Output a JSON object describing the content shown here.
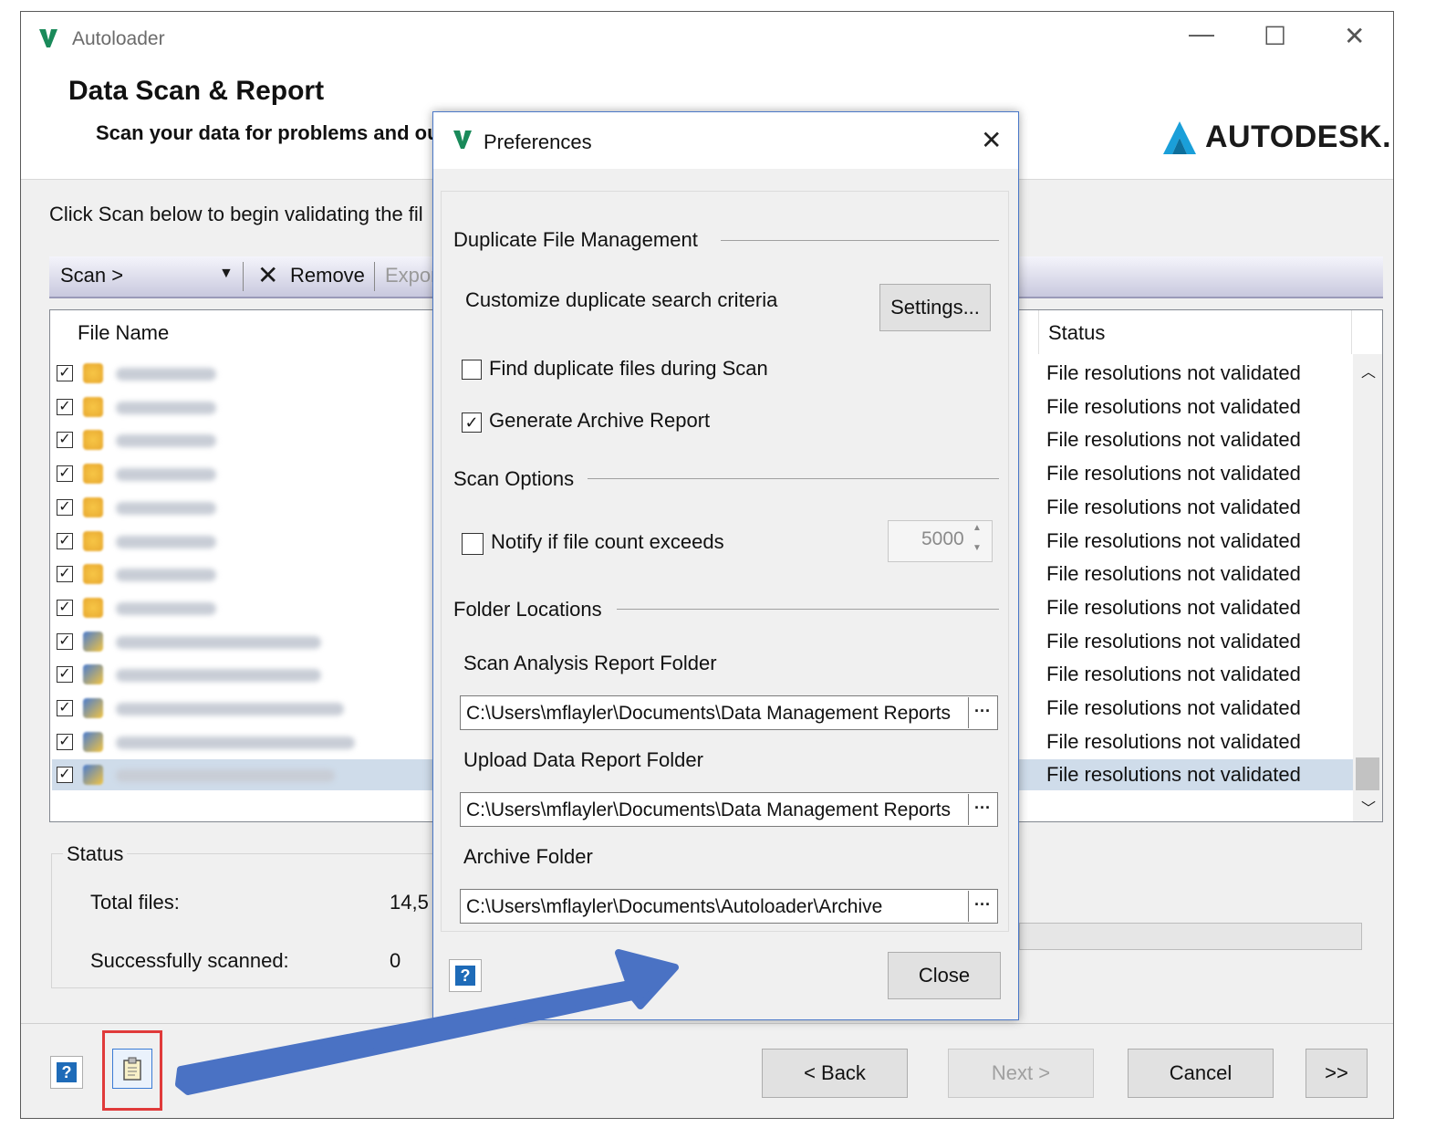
{
  "window": {
    "title": "Autoloader",
    "minimize_glyph": "—",
    "maximize_glyph": "☐",
    "close_glyph": "✕"
  },
  "header": {
    "heading": "Data Scan & Report",
    "subtitle": "Scan your data for problems and ou",
    "brand": "AUTODESK."
  },
  "instructions": "Click Scan below to begin validating the fil",
  "toolbar": {
    "scan_label": "Scan >",
    "remove_label": "Remove",
    "export_label": "Expor"
  },
  "file_list": {
    "col_file_name": "File Name",
    "col_status": "Status",
    "rows": [
      {
        "status": "File resolutions not validated",
        "checked": true,
        "icon": "part-icon"
      },
      {
        "status": "File resolutions not validated",
        "checked": true,
        "icon": "part-icon"
      },
      {
        "status": "File resolutions not validated",
        "checked": true,
        "icon": "part-icon"
      },
      {
        "status": "File resolutions not validated",
        "checked": true,
        "icon": "part-icon"
      },
      {
        "status": "File resolutions not validated",
        "checked": true,
        "icon": "part-icon"
      },
      {
        "status": "File resolutions not validated",
        "checked": true,
        "icon": "part-icon"
      },
      {
        "status": "File resolutions not validated",
        "checked": true,
        "icon": "part-icon"
      },
      {
        "status": "File resolutions not validated",
        "checked": true,
        "icon": "part-icon"
      },
      {
        "status": "File resolutions not validated",
        "checked": true,
        "icon": "drawing-icon"
      },
      {
        "status": "File resolutions not validated",
        "checked": true,
        "icon": "drawing-icon"
      },
      {
        "status": "File resolutions not validated",
        "checked": true,
        "icon": "drawing-icon"
      },
      {
        "status": "File resolutions not validated",
        "checked": true,
        "icon": "drawing-icon"
      },
      {
        "status": "File resolutions not validated",
        "checked": true,
        "icon": "drawing-icon"
      }
    ]
  },
  "status_group": {
    "label": "Status",
    "total_files_label": "Total files:",
    "total_files_value": "14,5",
    "scanned_label": "Successfully scanned:",
    "scanned_value": "0"
  },
  "footer": {
    "back_label": "< Back",
    "next_label": "Next >",
    "cancel_label": "Cancel",
    "more_label": ">>"
  },
  "preferences": {
    "title": "Preferences",
    "dup_group": "Duplicate File Management",
    "dup_criteria_label": "Customize duplicate search criteria",
    "settings_label": "Settings...",
    "find_dup_label": "Find duplicate files during Scan",
    "find_dup_checked": false,
    "archive_report_label": "Generate Archive Report",
    "archive_report_checked": true,
    "scan_group": "Scan Options",
    "notify_label": "Notify if file count exceeds",
    "notify_checked": false,
    "notify_value": "5000",
    "folder_group": "Folder Locations",
    "scan_report_folder_label": "Scan Analysis Report Folder",
    "scan_report_folder_value": "C:\\Users\\mflayler\\Documents\\Data Management Reports",
    "upload_folder_label": "Upload Data Report Folder",
    "upload_folder_value": "C:\\Users\\mflayler\\Documents\\Data Management Reports",
    "archive_folder_label": "Archive Folder",
    "archive_folder_value": "C:\\Users\\mflayler\\Documents\\Autoloader\\Archive",
    "browse_glyph": "···",
    "close_label": "Close"
  },
  "colors": {
    "annotation_arrow": "#4a72c4",
    "highlight_box": "#e03a3a",
    "autodesk_logo": "#1a9fd9"
  }
}
